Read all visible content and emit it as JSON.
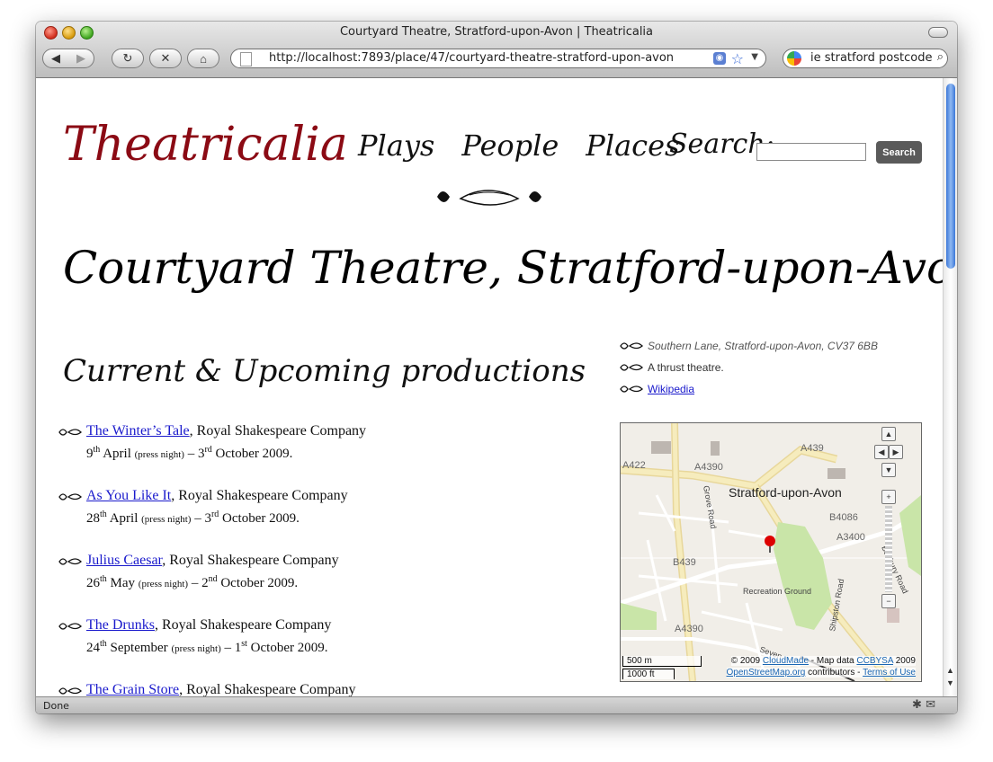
{
  "browser": {
    "window_title": "Courtyard Theatre, Stratford-upon-Avon | Theatricalia",
    "url": "http://localhost:7893/place/47/courtyard-theatre-stratford-upon-avon",
    "search_field_value": "ie stratford postcode",
    "status_text": "Done"
  },
  "site": {
    "logo": "Theatricalia",
    "nav": [
      "Plays",
      "People",
      "Places"
    ],
    "search_label": "Search:",
    "search_button": "Search"
  },
  "page": {
    "title": "Courtyard Theatre, Stratford-upon-Avon",
    "section_title": "Current & Upcoming productions"
  },
  "productions": [
    {
      "play": "The Winter’s Tale",
      "company": ", Royal Shakespeare Company",
      "start_day": "9",
      "start_suffix": "th",
      "start_month": "April",
      "press": "(press night)",
      "end_day": "3",
      "end_suffix": "rd",
      "end_rest": "October 2009."
    },
    {
      "play": "As You Like It",
      "company": ", Royal Shakespeare Company",
      "start_day": "28",
      "start_suffix": "th",
      "start_month": "April",
      "press": "(press night)",
      "end_day": "3",
      "end_suffix": "rd",
      "end_rest": "October 2009."
    },
    {
      "play": "Julius Caesar",
      "company": ", Royal Shakespeare Company",
      "start_day": "26",
      "start_suffix": "th",
      "start_month": "May",
      "press": "(press night)",
      "end_day": "2",
      "end_suffix": "nd",
      "end_rest": "October 2009."
    },
    {
      "play": "The Drunks",
      "company": ", Royal Shakespeare Company",
      "start_day": "24",
      "start_suffix": "th",
      "start_month": "September",
      "press": "(press night)",
      "end_day": "1",
      "end_suffix": "st",
      "end_rest": "October 2009."
    },
    {
      "play": "The Grain Store",
      "company": ", Royal Shakespeare Company",
      "start_day": "",
      "start_suffix": "",
      "start_month": "",
      "press": "",
      "end_day": "",
      "end_suffix": "",
      "end_rest": ""
    }
  ],
  "sidebar": {
    "address": "Southern Lane, Stratford-upon-Avon, CV37 6BB",
    "description": "A thrust theatre.",
    "link": "Wikipedia"
  },
  "map": {
    "city_label": "Stratford-upon-Avon",
    "roads": [
      "A439",
      "A422",
      "A4390",
      "Grove Road",
      "B4086",
      "A3400",
      "Banbury Road",
      "B439",
      "Recreation Ground",
      "Shipston Road",
      "A4390",
      "Seven"
    ],
    "scale_metric": "500 m",
    "scale_imperial": "1000 ft",
    "attr_prefix": "© 2009 ",
    "attr_cloudmade": "CloudMade",
    "attr_mid": " - Map data ",
    "attr_license": "CCBYSA",
    "attr_year": " 2009",
    "attr_osm": "OpenStreetMap.org",
    "attr_contrib": " contributors - ",
    "attr_terms": "Terms of Use"
  },
  "colors": {
    "logo": "#8b0a14",
    "link": "#1a1acc",
    "search_button": "#5a5a5a"
  }
}
